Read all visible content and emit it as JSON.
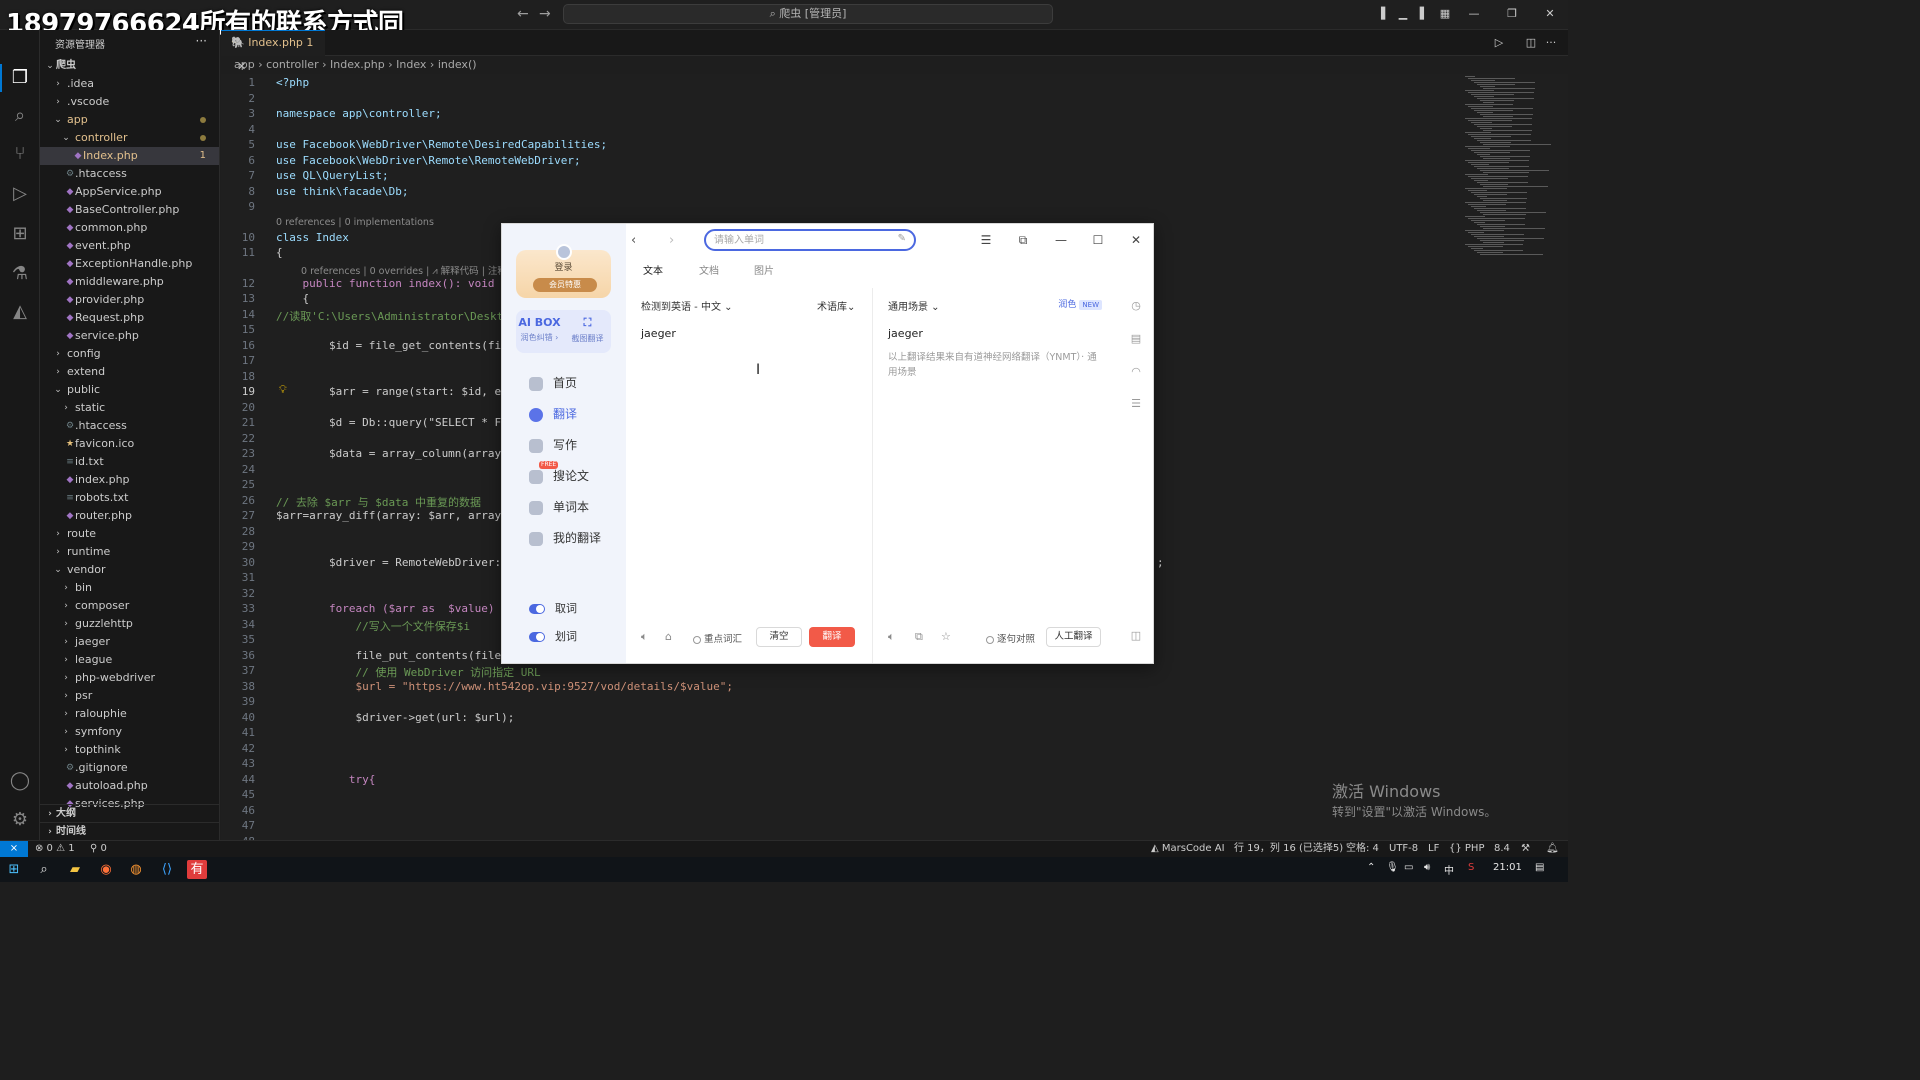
{
  "watermark": "18979766624所有的联系方式同",
  "titlebar": {
    "command_center": "爬虫 [管理员]",
    "back_icon": "arrow-left-icon",
    "forward_icon": "arrow-right-icon"
  },
  "sidebar": {
    "header": "资源管理器",
    "root": "爬虫",
    "tree": [
      {
        "label": ".idea",
        "type": "folder"
      },
      {
        "label": ".vscode",
        "type": "folder"
      },
      {
        "label": "app",
        "type": "folder-open"
      },
      {
        "label": "controller",
        "type": "folder-open"
      },
      {
        "label": "Index.php",
        "type": "php",
        "count": "1"
      },
      {
        "label": ".htaccess",
        "type": "cfg"
      },
      {
        "label": "AppService.php",
        "type": "php"
      },
      {
        "label": "BaseController.php",
        "type": "php"
      },
      {
        "label": "common.php",
        "type": "php"
      },
      {
        "label": "event.php",
        "type": "php"
      },
      {
        "label": "ExceptionHandle.php",
        "type": "php"
      },
      {
        "label": "middleware.php",
        "type": "php"
      },
      {
        "label": "provider.php",
        "type": "php"
      },
      {
        "label": "Request.php",
        "type": "php"
      },
      {
        "label": "service.php",
        "type": "php"
      },
      {
        "label": "config",
        "type": "folder"
      },
      {
        "label": "extend",
        "type": "folder"
      },
      {
        "label": "public",
        "type": "folder-open"
      },
      {
        "label": "static",
        "type": "folder"
      },
      {
        "label": ".htaccess",
        "type": "cfg"
      },
      {
        "label": "favicon.ico",
        "type": "star"
      },
      {
        "label": "id.txt",
        "type": "txt"
      },
      {
        "label": "index.php",
        "type": "php"
      },
      {
        "label": "robots.txt",
        "type": "txt"
      },
      {
        "label": "router.php",
        "type": "php"
      },
      {
        "label": "route",
        "type": "folder"
      },
      {
        "label": "runtime",
        "type": "folder"
      },
      {
        "label": "vendor",
        "type": "folder-open"
      },
      {
        "label": "bin",
        "type": "folder"
      },
      {
        "label": "composer",
        "type": "folder"
      },
      {
        "label": "guzzlehttp",
        "type": "folder"
      },
      {
        "label": "jaeger",
        "type": "folder"
      },
      {
        "label": "league",
        "type": "folder"
      },
      {
        "label": "php-webdriver",
        "type": "folder"
      },
      {
        "label": "psr",
        "type": "folder"
      },
      {
        "label": "ralouphie",
        "type": "folder"
      },
      {
        "label": "symfony",
        "type": "folder"
      },
      {
        "label": "topthink",
        "type": "folder"
      },
      {
        "label": ".gitignore",
        "type": "cfg"
      },
      {
        "label": "autoload.php",
        "type": "php"
      },
      {
        "label": "services.php",
        "type": "php"
      }
    ],
    "outline": "大纲",
    "timeline": "时间线"
  },
  "editor": {
    "tab_label": "Index.php",
    "tab_count": "1",
    "breadcrumb": [
      "app",
      "controller",
      "Index.php",
      "Index",
      "index()"
    ],
    "lens_class": "0 references | 0 implementations",
    "lens_method": "0 references | 0 overrides | ⩘ 解释代码 | 注释",
    "lines": [
      {
        "n": "1",
        "code": "<?php"
      },
      {
        "n": "2",
        "code": ""
      },
      {
        "n": "3",
        "code": "namespace app\\controller;"
      },
      {
        "n": "4",
        "code": ""
      },
      {
        "n": "5",
        "code": "use Facebook\\WebDriver\\Remote\\DesiredCapabilities;"
      },
      {
        "n": "6",
        "code": "use Facebook\\WebDriver\\Remote\\RemoteWebDriver;"
      },
      {
        "n": "7",
        "code": "use QL\\QueryList;"
      },
      {
        "n": "8",
        "code": "use think\\facade\\Db;"
      },
      {
        "n": "9",
        "code": ""
      },
      {
        "n": "10",
        "code": "class Index"
      },
      {
        "n": "11",
        "code": "{"
      },
      {
        "n": "12",
        "code": "    public function index(): void"
      },
      {
        "n": "13",
        "code": "    {"
      },
      {
        "n": "14",
        "code": "//读取'C:\\Users\\Administrator\\Deskto"
      },
      {
        "n": "15",
        "code": ""
      },
      {
        "n": "16",
        "code": "        $id = file_get_contents(file"
      },
      {
        "n": "17",
        "code": ""
      },
      {
        "n": "18",
        "code": ""
      },
      {
        "n": "19",
        "code": "        $arr = range(start: $id, end"
      },
      {
        "n": "20",
        "code": ""
      },
      {
        "n": "21",
        "code": "        $d = Db::query(\"SELECT * FRO"
      },
      {
        "n": "22",
        "code": ""
      },
      {
        "n": "23",
        "code": "        $data = array_column(array:"
      },
      {
        "n": "24",
        "code": ""
      },
      {
        "n": "25",
        "code": ""
      },
      {
        "n": "26",
        "code": "// 去除 $arr 与 $data 中重复的数据"
      },
      {
        "n": "27",
        "code": "$arr=array_diff(array: $arr, arrays:"
      },
      {
        "n": "28",
        "code": ""
      },
      {
        "n": "29",
        "code": ""
      },
      {
        "n": "30",
        "code": "        $driver = RemoteWebDriver::c"
      },
      {
        "n": "31",
        "code": ""
      },
      {
        "n": "32",
        "code": ""
      },
      {
        "n": "33",
        "code": "        foreach ($arr as  $value) {"
      },
      {
        "n": "34",
        "code": "            //写入一个文件保存$i"
      },
      {
        "n": "35",
        "code": ""
      },
      {
        "n": "36",
        "code": "            file_put_contents(filena"
      },
      {
        "n": "37",
        "code": "            // 使用 WebDriver 访问指定 URL"
      },
      {
        "n": "38",
        "code": "            $url = \"https://www.ht542op.vip:9527/vod/details/$value\";"
      },
      {
        "n": "39",
        "code": ""
      },
      {
        "n": "40",
        "code": "            $driver->get(url: $url);"
      },
      {
        "n": "41",
        "code": ""
      },
      {
        "n": "42",
        "code": ""
      },
      {
        "n": "43",
        "code": ""
      },
      {
        "n": "44",
        "code": "           try{"
      },
      {
        "n": "45",
        "code": ""
      },
      {
        "n": "46",
        "code": ""
      },
      {
        "n": "47",
        "code": ""
      },
      {
        "n": "48",
        "code": ""
      }
    ],
    "line30_tail": ";"
  },
  "dialog": {
    "login": "登录",
    "vip": "会员特惠",
    "tools": [
      {
        "icon": "AI BOX",
        "label": "润色纠错 ›"
      },
      {
        "icon": "crop-icon",
        "label": "截图翻译"
      }
    ],
    "nav": [
      {
        "label": "首页",
        "active": false
      },
      {
        "label": "翻译",
        "active": true
      },
      {
        "label": "写作",
        "active": false
      },
      {
        "label": "搜论文",
        "active": false,
        "tag": "FREE"
      },
      {
        "label": "单词本",
        "active": false
      },
      {
        "label": "我的翻译",
        "active": false
      }
    ],
    "toggles": [
      "取词",
      "划词"
    ],
    "search_placeholder": "请输入单词",
    "tabs": [
      "文本",
      "文档",
      "图片"
    ],
    "src_lang": "检测到英语 - 中文 ⌄",
    "term_lib": "术语库⌄",
    "scene": "通用场景 ⌄",
    "polish": "润色",
    "new_badge": "NEW",
    "source_text": "jaeger",
    "target_text": "jaeger",
    "target_note": "以上翻译结果来自有道神经网络翻译（YNMT）· 通用场景",
    "key_vocab": "重点词汇",
    "clear": "清空",
    "translate": "翻译",
    "sentence_compare": "逐句对照",
    "human_translate": "人工翻译"
  },
  "statusbar": {
    "errors": "⊗ 0 ⚠ 1",
    "ports": "⚲ 0",
    "marscode": "MarsCode AI",
    "position": "行 19，列 16 (已选择5)",
    "spaces": "空格: 4",
    "encoding": "UTF-8",
    "eol": "LF",
    "language": "{} PHP",
    "version": "8.4"
  },
  "activate": {
    "line1": "激活 Windows",
    "line2": "转到\"设置\"以激活 Windows。"
  },
  "taskbar": {
    "ime": "中",
    "time": "21:01"
  },
  "colors": {
    "accent": "#0078d4",
    "translate_btn": "#f25a48",
    "dict_blue": "#4b68e0"
  }
}
